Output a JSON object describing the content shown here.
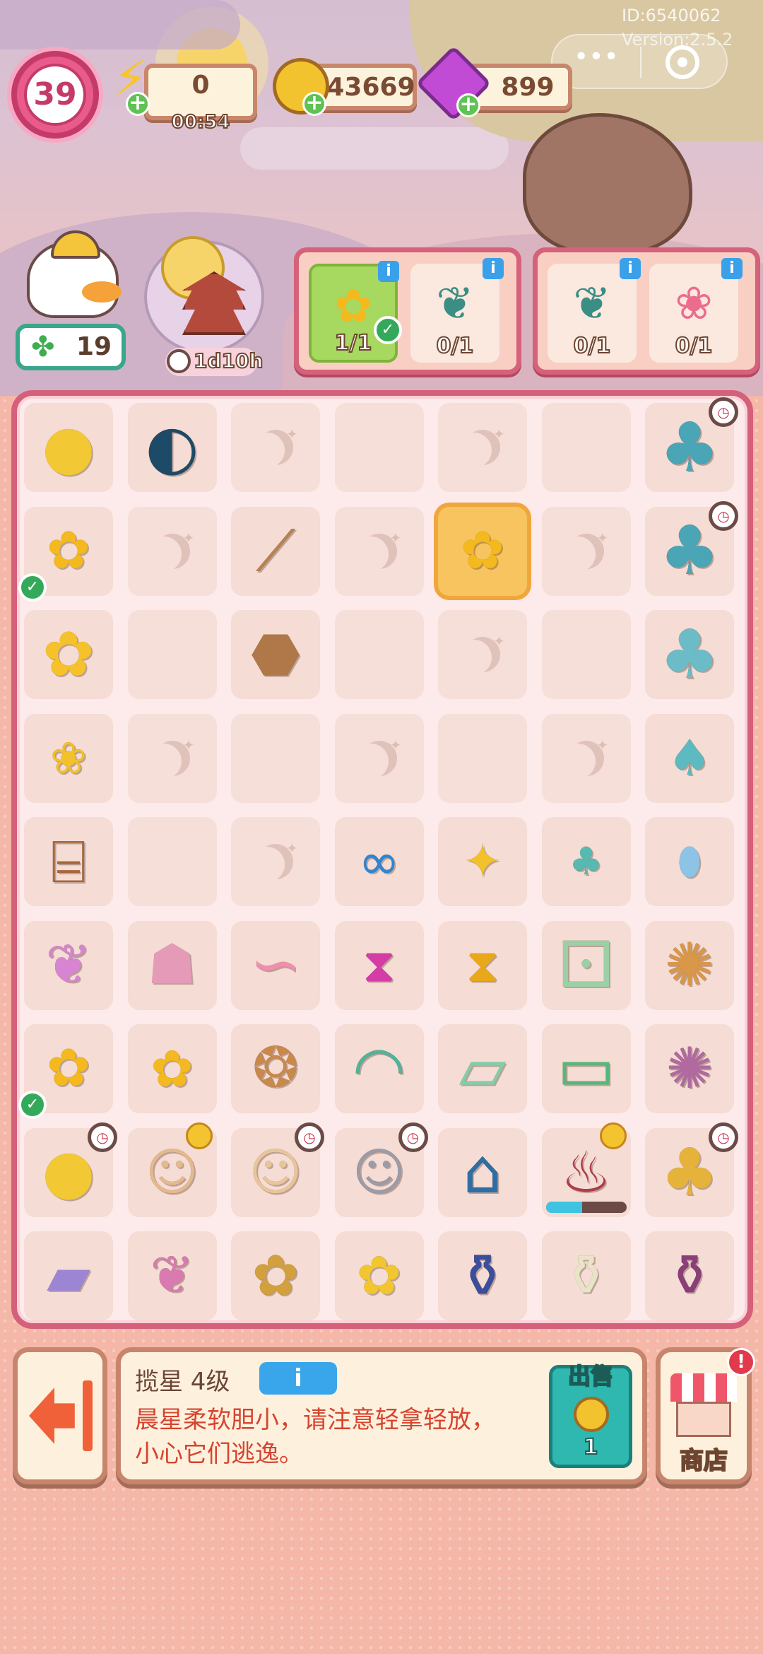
{
  "overlay": {
    "id": "ID:6540062",
    "version": "Version:2.5.2",
    "menu_dots": "•••"
  },
  "hud": {
    "level": "39",
    "energy": "0",
    "energy_timer": "00:54",
    "coins": "43669",
    "gems": "899"
  },
  "clover_count": "19",
  "event_timer": "1d10h",
  "orders": {
    "order1": {
      "count_a": "1/1",
      "count_b": "0/1"
    },
    "order2": {
      "count_a": "0/1",
      "count_b": "0/1"
    }
  },
  "item": {
    "name": "揽星 4级",
    "description": "晨星柔软胆小，请注意轻拿轻放，小心它们逃逸。",
    "sell_label": "出售",
    "sell_price": "1"
  },
  "shop": {
    "label": "商店",
    "badge": "!"
  },
  "colors": {
    "accent": "#d4607a",
    "panel_border": "#c7856e",
    "info_blue": "#3aa0ea",
    "sell_teal": "#2fb8b0"
  },
  "board": {
    "rows": 9,
    "cols": 7,
    "items": [
      [
        "moon-full-icon",
        "moon-half-icon",
        "lock",
        "empty",
        "lock",
        "empty",
        "moon-tree-icon"
      ],
      [
        "osmanthus-branch-icon",
        "lock",
        "twig-icon",
        "lock",
        "osmanthus-basket-icon",
        "lock",
        "moon-tree-icon"
      ],
      [
        "osmanthus-flower-icon",
        "empty",
        "pinecone-stack-icon",
        "empty",
        "lock",
        "empty",
        "blue-tree-icon"
      ],
      [
        "osmanthus-sprig-icon",
        "lock",
        "empty",
        "lock",
        "empty",
        "lock",
        "sapling-icon"
      ],
      [
        "wooden-rack-icon",
        "empty",
        "lock",
        "infinity-hex-icon",
        "osmanthus-petals-icon",
        "sprout-icon",
        "seed-icon"
      ],
      [
        "silk-dress-icon",
        "silk-cloth-icon",
        "silk-ribbon-icon",
        "pink-hourglass-hex-icon",
        "gold-hourglass-hex-icon",
        "dice-icon",
        "mooncake-icon"
      ],
      [
        "osmanthus-branch-icon",
        "flower-basket-icon",
        "bread-bowl-icon",
        "jade-plate-icon",
        "jade-dish-icon",
        "jade-tray-icon",
        "taro-mooncake-icon"
      ],
      [
        "moon-full-icon",
        "bunny-mortar-icon",
        "bunny-bowl-icon",
        "bunny-stir-icon",
        "pagoda-cloud-icon",
        "teapot-icon",
        "golden-tree-icon"
      ],
      [
        "folded-cloth-icon",
        "bunny-dress-icon",
        "flower-basket-big-icon",
        "jelly-cake-icon",
        "wine-jar-icon",
        "sake-set-icon",
        "jam-jar-icon"
      ]
    ]
  }
}
